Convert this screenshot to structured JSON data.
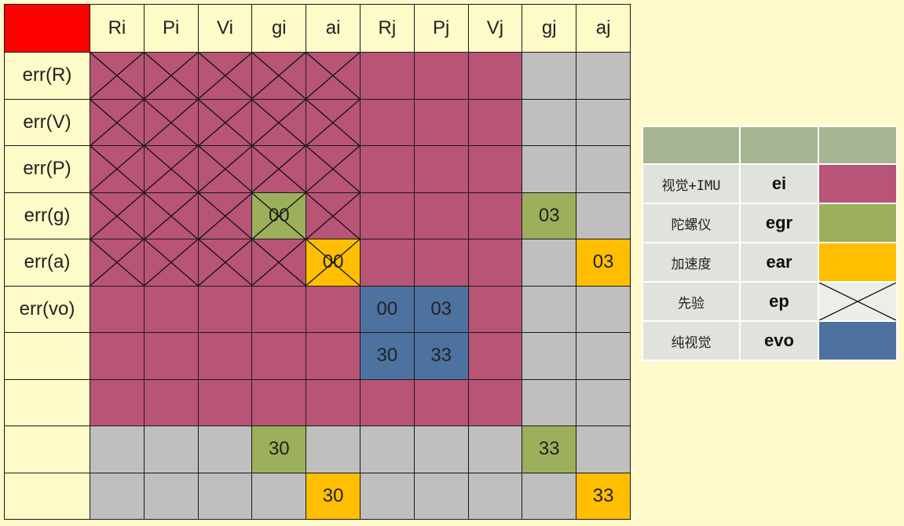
{
  "colors": {
    "ei": "#b85475",
    "egr": "#9cb05c",
    "ear": "#ffbf00",
    "evo": "#4d72a0",
    "empty": "#bfbfbf",
    "ep": "#ebefe8",
    "header": "#fffbc8",
    "corner": "#ff0000"
  },
  "matrix": {
    "col_headers": [
      "Ri",
      "Pi",
      "Vi",
      "gi",
      "ai",
      "Rj",
      "Pj",
      "Vj",
      "gj",
      "aj"
    ],
    "row_headers": [
      "err(R)",
      "err(V)",
      "err(P)",
      "err(g)",
      "err(a)",
      "err(vo)",
      "",
      "",
      "",
      ""
    ],
    "rows": [
      [
        {
          "f": "ei",
          "x": true
        },
        {
          "f": "ei",
          "x": true
        },
        {
          "f": "ei",
          "x": true
        },
        {
          "f": "ei",
          "x": true
        },
        {
          "f": "ei",
          "x": true
        },
        {
          "f": "ei"
        },
        {
          "f": "ei"
        },
        {
          "f": "ei"
        },
        {
          "f": "empty"
        },
        {
          "f": "empty"
        }
      ],
      [
        {
          "f": "ei",
          "x": true
        },
        {
          "f": "ei",
          "x": true
        },
        {
          "f": "ei",
          "x": true
        },
        {
          "f": "ei",
          "x": true
        },
        {
          "f": "ei",
          "x": true
        },
        {
          "f": "ei"
        },
        {
          "f": "ei"
        },
        {
          "f": "ei"
        },
        {
          "f": "empty"
        },
        {
          "f": "empty"
        }
      ],
      [
        {
          "f": "ei",
          "x": true
        },
        {
          "f": "ei",
          "x": true
        },
        {
          "f": "ei",
          "x": true
        },
        {
          "f": "ei",
          "x": true
        },
        {
          "f": "ei",
          "x": true
        },
        {
          "f": "ei"
        },
        {
          "f": "ei"
        },
        {
          "f": "ei"
        },
        {
          "f": "empty"
        },
        {
          "f": "empty"
        }
      ],
      [
        {
          "f": "ei",
          "x": true
        },
        {
          "f": "ei",
          "x": true
        },
        {
          "f": "ei",
          "x": true
        },
        {
          "f": "egr",
          "x": true,
          "t": "00"
        },
        {
          "f": "ei",
          "x": true
        },
        {
          "f": "ei"
        },
        {
          "f": "ei"
        },
        {
          "f": "ei"
        },
        {
          "f": "egr",
          "t": "03"
        },
        {
          "f": "empty"
        }
      ],
      [
        {
          "f": "ei",
          "x": true
        },
        {
          "f": "ei",
          "x": true
        },
        {
          "f": "ei",
          "x": true
        },
        {
          "f": "ei",
          "x": true
        },
        {
          "f": "ear",
          "x": true,
          "t": "00"
        },
        {
          "f": "ei"
        },
        {
          "f": "ei"
        },
        {
          "f": "ei"
        },
        {
          "f": "empty"
        },
        {
          "f": "ear",
          "t": "03"
        }
      ],
      [
        {
          "f": "ei"
        },
        {
          "f": "ei"
        },
        {
          "f": "ei"
        },
        {
          "f": "ei"
        },
        {
          "f": "ei"
        },
        {
          "f": "evo",
          "t": "00"
        },
        {
          "f": "evo",
          "t": "03"
        },
        {
          "f": "ei"
        },
        {
          "f": "empty"
        },
        {
          "f": "empty"
        }
      ],
      [
        {
          "f": "ei"
        },
        {
          "f": "ei"
        },
        {
          "f": "ei"
        },
        {
          "f": "ei"
        },
        {
          "f": "ei"
        },
        {
          "f": "evo",
          "t": "30"
        },
        {
          "f": "evo",
          "t": "33"
        },
        {
          "f": "ei"
        },
        {
          "f": "empty"
        },
        {
          "f": "empty"
        }
      ],
      [
        {
          "f": "ei"
        },
        {
          "f": "ei"
        },
        {
          "f": "ei"
        },
        {
          "f": "ei"
        },
        {
          "f": "ei"
        },
        {
          "f": "ei"
        },
        {
          "f": "ei"
        },
        {
          "f": "ei"
        },
        {
          "f": "empty"
        },
        {
          "f": "empty"
        }
      ],
      [
        {
          "f": "empty"
        },
        {
          "f": "empty"
        },
        {
          "f": "empty"
        },
        {
          "f": "egr",
          "t": "30"
        },
        {
          "f": "empty"
        },
        {
          "f": "empty"
        },
        {
          "f": "empty"
        },
        {
          "f": "empty"
        },
        {
          "f": "egr",
          "t": "33"
        },
        {
          "f": "empty"
        }
      ],
      [
        {
          "f": "empty"
        },
        {
          "f": "empty"
        },
        {
          "f": "empty"
        },
        {
          "f": "empty"
        },
        {
          "f": "ear",
          "t": "30"
        },
        {
          "f": "empty"
        },
        {
          "f": "empty"
        },
        {
          "f": "empty"
        },
        {
          "f": "empty"
        },
        {
          "f": "ear",
          "t": "33"
        }
      ]
    ]
  },
  "legend": {
    "items": [
      {
        "name": "视觉+IMU",
        "code": "ei",
        "key": "ei"
      },
      {
        "name": "陀螺仪",
        "code": "egr",
        "key": "egr"
      },
      {
        "name": "加速度",
        "code": "ear",
        "key": "ear"
      },
      {
        "name": "先验",
        "code": "ep",
        "key": "ep",
        "cross": true
      },
      {
        "name": "纯视觉",
        "code": "evo",
        "key": "evo"
      }
    ]
  }
}
